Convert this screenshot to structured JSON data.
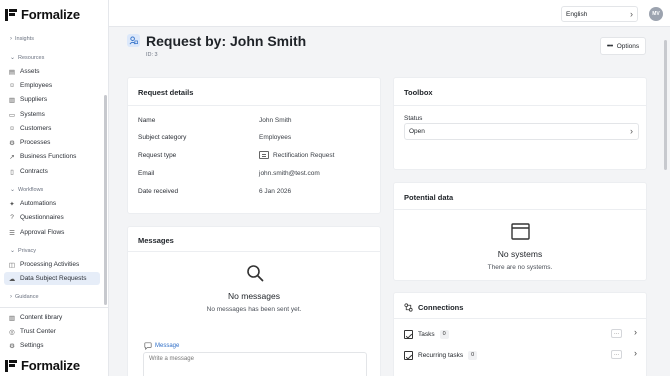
{
  "app": {
    "name": "Formalize"
  },
  "sidebar": {
    "insights_label": "Insights",
    "sections": {
      "resources": "Resources",
      "workflows": "Workflows",
      "privacy": "Privacy",
      "guidance": "Guidance"
    },
    "items": [
      {
        "label": "Assets",
        "icon": "asset-icon"
      },
      {
        "label": "Employees",
        "icon": "employees-icon"
      },
      {
        "label": "Suppliers",
        "icon": "suppliers-icon"
      },
      {
        "label": "Systems",
        "icon": "systems-icon"
      },
      {
        "label": "Customers",
        "icon": "customers-icon"
      },
      {
        "label": "Processes",
        "icon": "processes-icon"
      },
      {
        "label": "Business Functions",
        "icon": "business-functions-icon"
      },
      {
        "label": "Contracts",
        "icon": "contracts-icon"
      },
      {
        "label": "Automations",
        "icon": "automations-icon"
      },
      {
        "label": "Questionnaires",
        "icon": "questionnaires-icon"
      },
      {
        "label": "Approval Flows",
        "icon": "approval-flows-icon"
      },
      {
        "label": "Processing Activities",
        "icon": "processing-activities-icon"
      },
      {
        "label": "Data Subject Requests",
        "icon": "data-subject-requests-icon",
        "active": true
      }
    ],
    "bottom_items": [
      {
        "label": "Content library",
        "icon": "content-library-icon"
      },
      {
        "label": "Trust Center",
        "icon": "trust-center-icon"
      },
      {
        "label": "Settings",
        "icon": "settings-icon"
      }
    ]
  },
  "topbar": {
    "language": "English",
    "avatar_initials": "MV"
  },
  "header": {
    "title": "Request by: John Smith",
    "id_text": "ID: 3",
    "options_label": "Options"
  },
  "request_details": {
    "title": "Request details",
    "rows": [
      {
        "label": "Name",
        "value": "John Smith"
      },
      {
        "label": "Subject category",
        "value": "Employees"
      },
      {
        "label": "Request type",
        "value": "Rectification Request"
      },
      {
        "label": "Email",
        "value": "john.smith@test.com"
      },
      {
        "label": "Date received",
        "value": "6 Jan 2026"
      }
    ]
  },
  "messages": {
    "title": "Messages",
    "empty_title": "No messages",
    "empty_sub": "No messages has been sent yet.",
    "composer_label": "Message",
    "composer_placeholder": "Write a message"
  },
  "toolbox": {
    "title": "Toolbox",
    "status_label": "Status",
    "status_value": "Open"
  },
  "potential_data": {
    "title": "Potential data",
    "empty_title": "No systems",
    "empty_sub": "There are no systems."
  },
  "connections": {
    "title": "Connections",
    "rows": [
      {
        "label": "Tasks",
        "count": "0"
      },
      {
        "label": "Recurring tasks",
        "count": "0"
      }
    ]
  },
  "colors": {
    "accent": "#2f6fc8",
    "active_bg": "#e6edf8",
    "page_bg": "#f3f4f6"
  }
}
